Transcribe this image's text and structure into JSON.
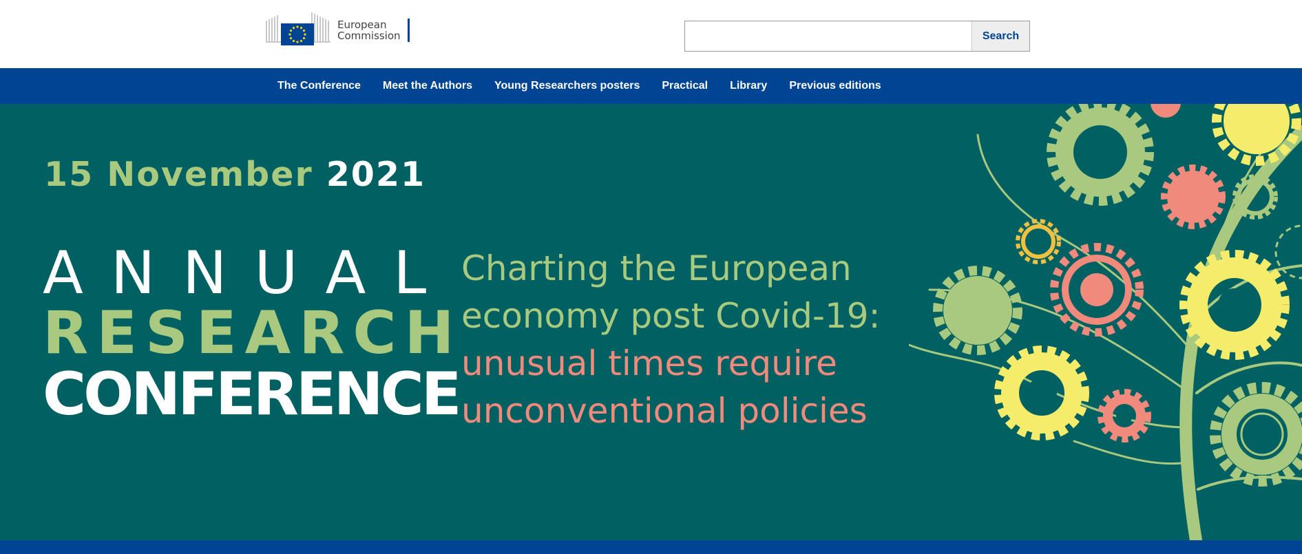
{
  "header": {
    "logo": {
      "line1": "European",
      "line2": "Commission"
    },
    "search": {
      "value": "",
      "placeholder": "",
      "button_label": "Search"
    }
  },
  "nav": {
    "items": [
      {
        "label": "The Conference"
      },
      {
        "label": "Meet the Authors"
      },
      {
        "label": "Young Researchers posters"
      },
      {
        "label": "Practical"
      },
      {
        "label": "Library"
      },
      {
        "label": "Previous editions"
      }
    ]
  },
  "hero": {
    "date_day": "15 November",
    "date_year": "2021",
    "title_line1": "ANNUAL",
    "title_line2": "RESEARCH",
    "title_line3": "CONFERENCE",
    "tagline": {
      "line1": "Charting the European",
      "line2": "economy post Covid-19:",
      "line3": "unusual times require",
      "line4": "unconventional policies"
    }
  },
  "colors": {
    "brand_blue": "#004494",
    "hero_teal": "#006062",
    "accent_green": "#a8c97e",
    "accent_pink": "#f08a7c",
    "accent_yellow": "#f4ec6a"
  }
}
